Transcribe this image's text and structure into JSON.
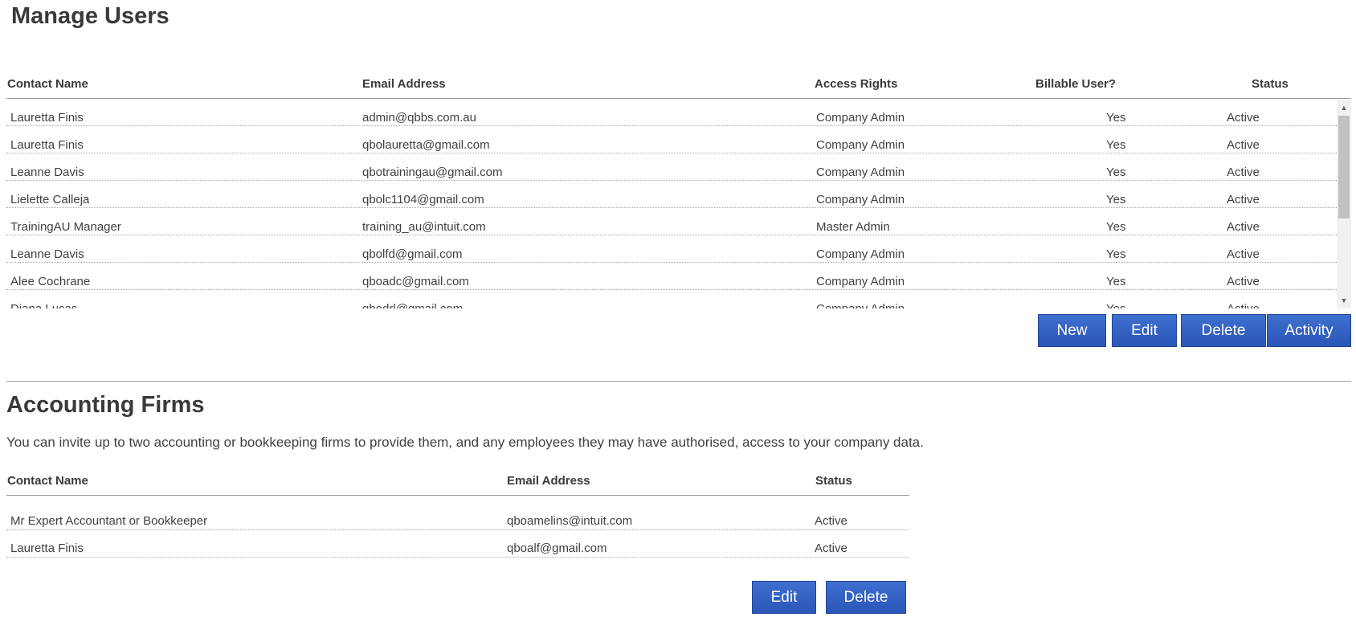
{
  "users": {
    "title": "Manage Users",
    "columns": [
      "Contact Name",
      "Email Address",
      "Access Rights",
      "Billable User?",
      "Status"
    ],
    "rows": [
      {
        "name": "Lauretta Finis",
        "email": "admin@qbbs.com.au",
        "access": "Company Admin",
        "billable": "Yes",
        "status": "Active"
      },
      {
        "name": "Lauretta Finis",
        "email": "qbolauretta@gmail.com",
        "access": "Company Admin",
        "billable": "Yes",
        "status": "Active"
      },
      {
        "name": "Leanne Davis",
        "email": "qbotrainingau@gmail.com",
        "access": "Company Admin",
        "billable": "Yes",
        "status": "Active"
      },
      {
        "name": "Lielette Calleja",
        "email": "qbolc1104@gmail.com",
        "access": "Company Admin",
        "billable": "Yes",
        "status": "Active"
      },
      {
        "name": "TrainingAU Manager",
        "email": "training_au@intuit.com",
        "access": "Master Admin",
        "billable": "Yes",
        "status": "Active"
      },
      {
        "name": "Leanne Davis",
        "email": "qbolfd@gmail.com",
        "access": "Company Admin",
        "billable": "Yes",
        "status": "Active"
      },
      {
        "name": "Alee Cochrane",
        "email": "qboadc@gmail.com",
        "access": "Company Admin",
        "billable": "Yes",
        "status": "Active"
      },
      {
        "name": "Diana Lucas",
        "email": "qbodrl@gmail.com",
        "access": "Company Admin",
        "billable": "Yes",
        "status": "Active"
      }
    ],
    "buttons": {
      "new": "New",
      "edit": "Edit",
      "delete": "Delete",
      "activity": "Activity"
    }
  },
  "firms": {
    "title": "Accounting Firms",
    "description": "You can invite up to two accounting or bookkeeping firms to provide them, and any employees they may have authorised, access to your company data.",
    "columns": [
      "Contact Name",
      "Email Address",
      "Status"
    ],
    "rows": [
      {
        "name": "Mr Expert Accountant or Bookkeeper",
        "email": "qboamelins@intuit.com",
        "status": "Active"
      },
      {
        "name": "Lauretta Finis",
        "email": "qboalf@gmail.com",
        "status": "Active"
      }
    ],
    "buttons": {
      "edit": "Edit",
      "delete": "Delete"
    }
  },
  "colors": {
    "button": "#2f5fc4",
    "text": "#404040",
    "heading": "#393a3d"
  },
  "icons": {
    "scroll_up": "triangle-up-icon",
    "scroll_down": "triangle-down-icon"
  }
}
